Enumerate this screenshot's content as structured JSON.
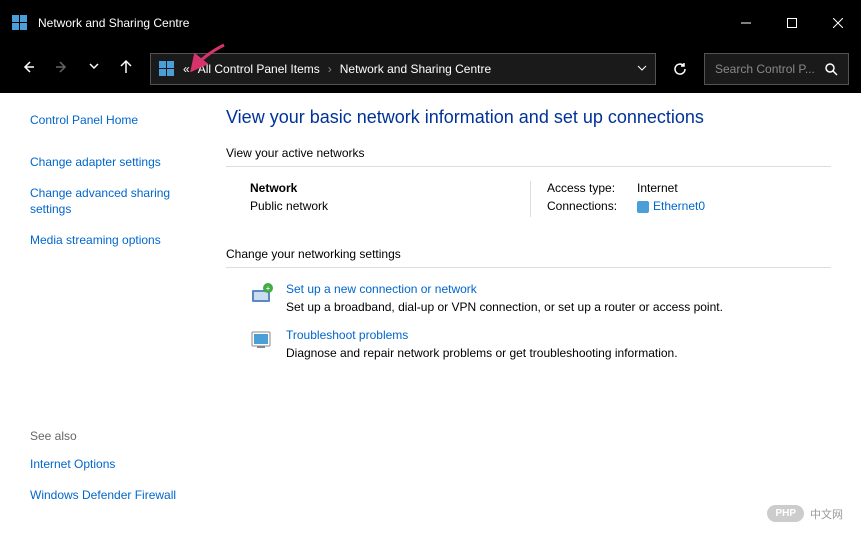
{
  "window": {
    "title": "Network and Sharing Centre"
  },
  "breadcrumb": {
    "prefix": "«",
    "items": [
      "All Control Panel Items",
      "Network and Sharing Centre"
    ]
  },
  "search": {
    "placeholder": "Search Control P..."
  },
  "sidebar": {
    "home": "Control Panel Home",
    "links": [
      "Change adapter settings",
      "Change advanced sharing settings",
      "Media streaming options"
    ],
    "see_also_label": "See also",
    "see_also": [
      "Internet Options",
      "Windows Defender Firewall"
    ]
  },
  "main": {
    "title": "View your basic network information and set up connections",
    "active_networks_header": "View your active networks",
    "network": {
      "name": "Network",
      "type": "Public network",
      "access_label": "Access type:",
      "access_value": "Internet",
      "connections_label": "Connections:",
      "connections_value": "Ethernet0"
    },
    "settings_header": "Change your networking settings",
    "actions": [
      {
        "title": "Set up a new connection or network",
        "desc": "Set up a broadband, dial-up or VPN connection, or set up a router or access point."
      },
      {
        "title": "Troubleshoot problems",
        "desc": "Diagnose and repair network problems or get troubleshooting information."
      }
    ]
  },
  "watermark": {
    "badge": "PHP",
    "text": "中文网"
  }
}
